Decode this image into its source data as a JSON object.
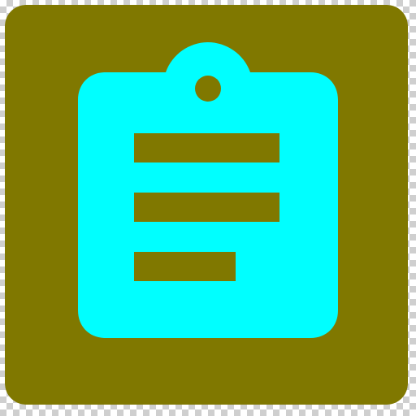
{
  "icon": {
    "name": "clipboard-list-icon",
    "colors": {
      "tile_background": "#807800",
      "clipboard": "#00FFFF",
      "lines": "#807800",
      "canvas_checker_light": "#ffffff",
      "canvas_checker_dark": "#cfcfcf"
    }
  }
}
